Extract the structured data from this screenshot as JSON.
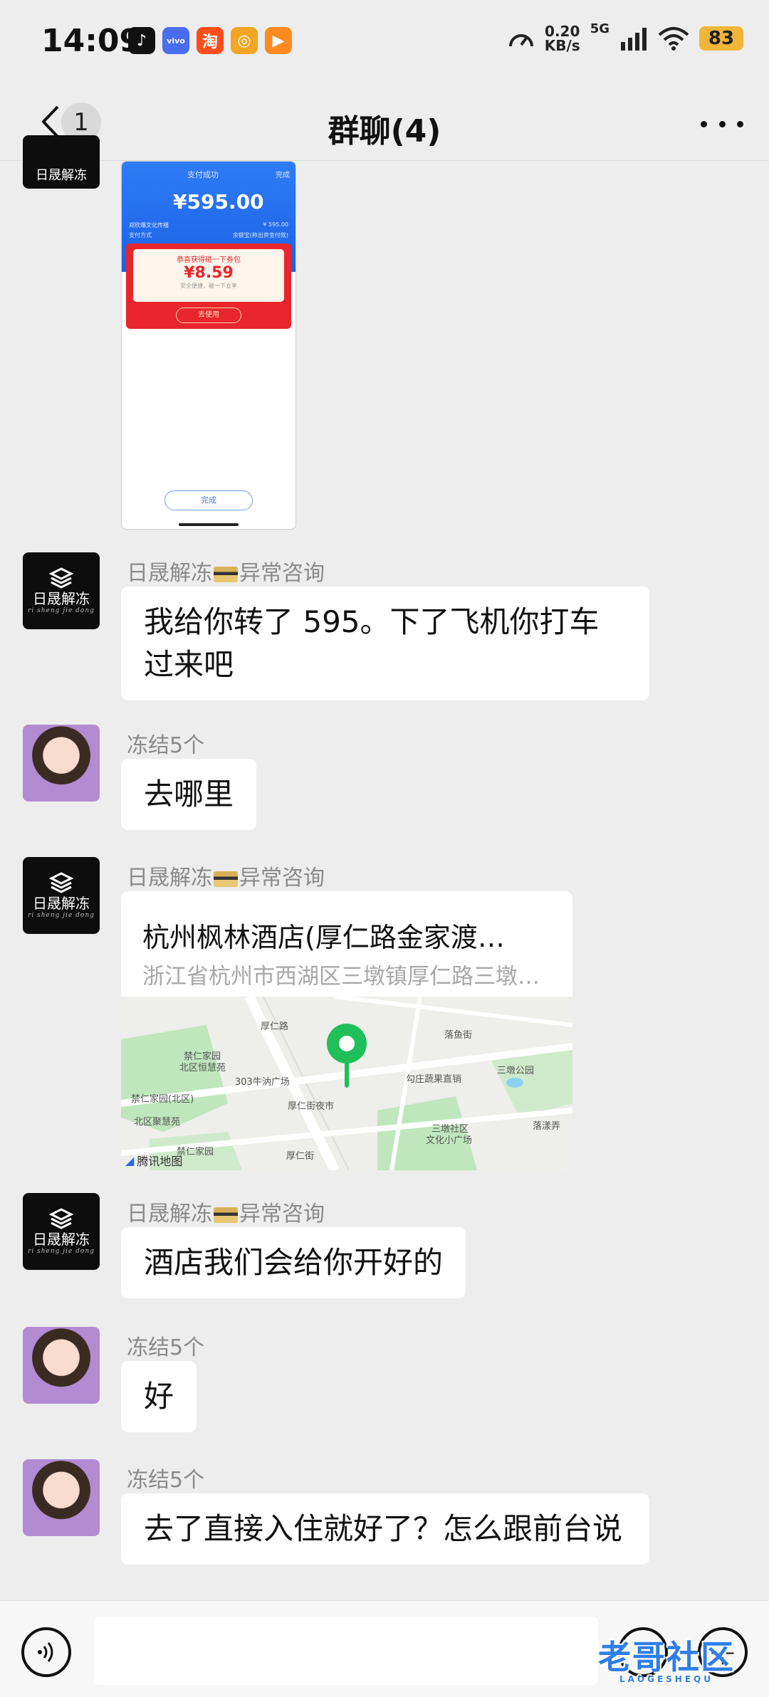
{
  "status_bar": {
    "time": "14:09",
    "net_speed": "0.20",
    "net_speed_unit": "KB/s",
    "network": "5G",
    "battery": "83",
    "app_icons": [
      "tiktok-icon",
      "vivo-icon",
      "taobao-icon",
      "app-icon",
      "video-icon"
    ]
  },
  "header": {
    "unread_count": "1",
    "title": "群聊(4)"
  },
  "payment_image": {
    "status": "支付成功",
    "done_top": "完成",
    "amount": "¥595.00",
    "row1_label": "郑欣爆文化传播",
    "row1_value": "¥ 595.00",
    "row2_label": "支付方式",
    "row2_value": "余额宝(称出资金付款)",
    "red_packet_title": "恭喜获得碰一下券包",
    "red_packet_amount": "¥8.59",
    "red_packet_sub": "安全便捷，碰一下立享",
    "red_packet_button": "去使用",
    "done_button": "完成"
  },
  "messages": [
    {
      "sender": "日晟解冻",
      "sender_suffix": "异常咨询",
      "text": "我给你转了 595。下了飞机你打车过来吧"
    },
    {
      "sender": "冻结5个",
      "text": "去哪里"
    },
    {
      "sender": "日晟解冻",
      "sender_suffix": "异常咨询",
      "location_title": "杭州枫林酒店(厚仁路金家渡…",
      "location_address": "浙江省杭州市西湖区三墩镇厚仁路三墩…",
      "map_provider": "腾讯地图"
    },
    {
      "sender": "日晟解冻",
      "sender_suffix": "异常咨询",
      "text": "酒店我们会给你开好的"
    },
    {
      "sender": "冻结5个",
      "text": "好"
    },
    {
      "sender": "冻结5个",
      "text": "去了直接入住就好了？怎么跟前台说"
    }
  ],
  "avatar_text": {
    "cn": "日晟解冻",
    "py": "ri sheng jie dong"
  },
  "map_labels": {
    "l1": "禁仁家园",
    "l2": "北区恒慧苑",
    "l3": "303牛汭广场",
    "l4": "禁仁家园(北区)",
    "l5": "北区聚慧苑",
    "l6": "禁仁家园",
    "l7": "厚仁街夜市",
    "l8": "厚仁街",
    "l9": "勾庄蔬果直销",
    "l10": "三墩公园",
    "l11": "三墩社区",
    "l12": "文化小广场",
    "l13": "落鱼街",
    "l14": "落漾弄",
    "l15": "厚仁路"
  },
  "watermark": {
    "text": "老哥社区",
    "sub": "LAOGESHEQU"
  }
}
